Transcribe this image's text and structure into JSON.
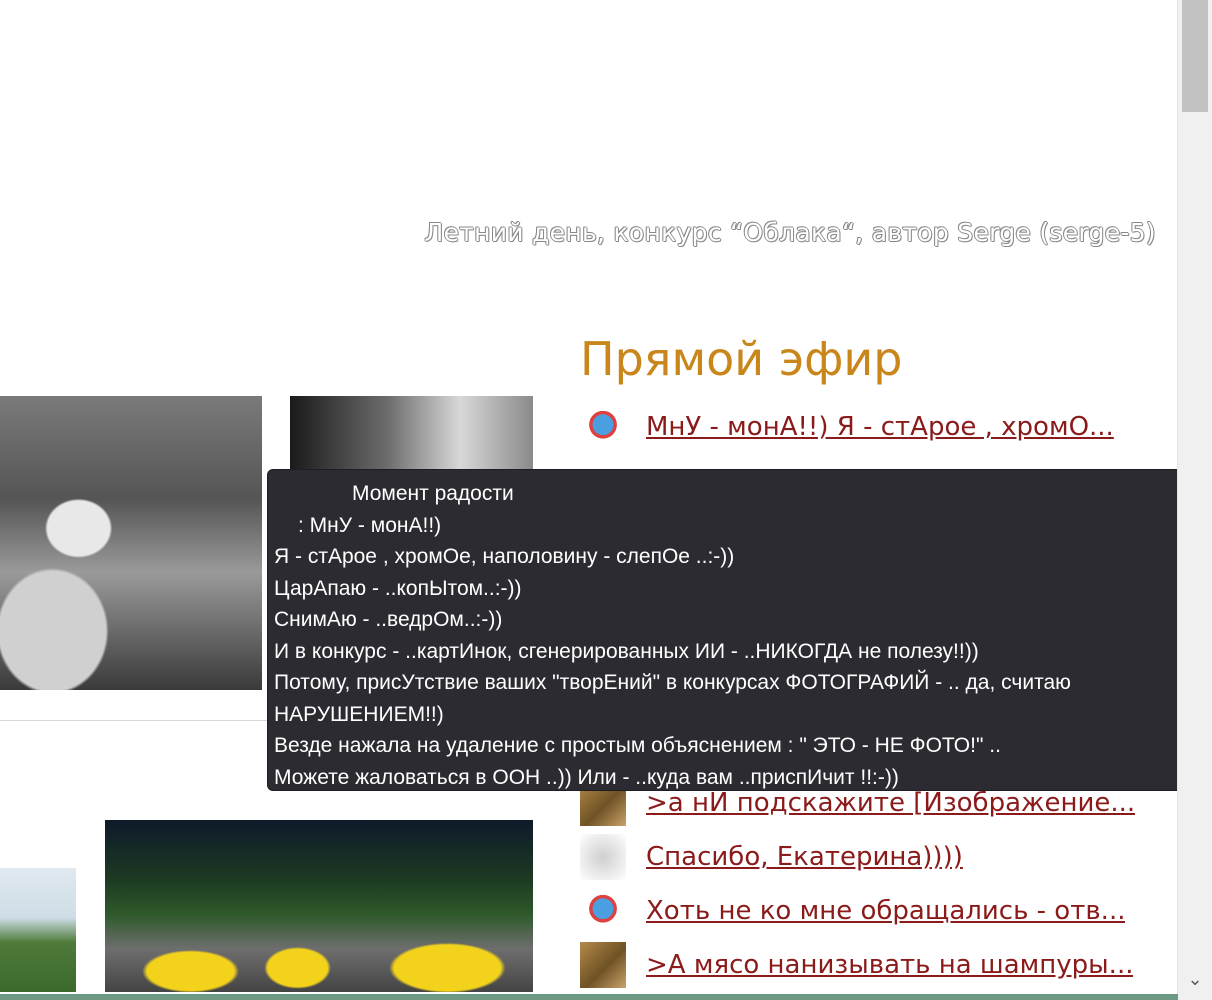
{
  "photo_caption": "Летний день, конкурс “Облака“, автор Serge (serge-5)",
  "live": {
    "title": "Прямой эфир",
    "items": [
      {
        "avatar": "horse-avatar",
        "text": "МнУ - монА!!) Я - стАрое , хромО..."
      },
      {
        "avatar": "photo-avatar",
        "text": ">а нИ подскажите [Изображение..."
      },
      {
        "avatar": "blurred-avatar",
        "text": "Спасибо, Екатерина))))"
      },
      {
        "avatar": "horse-avatar",
        "text": "Хоть не ко мне обращались - отв..."
      },
      {
        "avatar": "photo-avatar",
        "text": ">А мясо нанизывать на шампуры..."
      }
    ]
  },
  "tooltip": {
    "title": "Момент радости",
    "author_line": ": МнУ -    монА!!)",
    "lines": [
      "Я -    стАрое , хромОе, наполовину - слепОе ..:-))",
      "ЦарАпаю  - ..копЫтом..:-))",
      "СнимАю - ..ведрОм..:-))",
      "И в  конкурс - ..картИнок, сгенерированных ИИ  - ..НИКОГДА  не  полезу!!))",
      "Потому, присУтствие  ваших \"творЕний\" в конкурсах  ФОТОГРАФИЙ - .. да, считаю",
      "НАРУШЕНИЕМ!!)",
      "Везде нажала на  удаление с простым объяснением : \" ЭТО - НЕ ФОТО!\" ..",
      "Можете жаловаться в ООН ..))  Или - ..куда  вам ..приспИчит !!:-))"
    ]
  },
  "scrollbar": {
    "down_arrow": "chevron-down-icon"
  }
}
